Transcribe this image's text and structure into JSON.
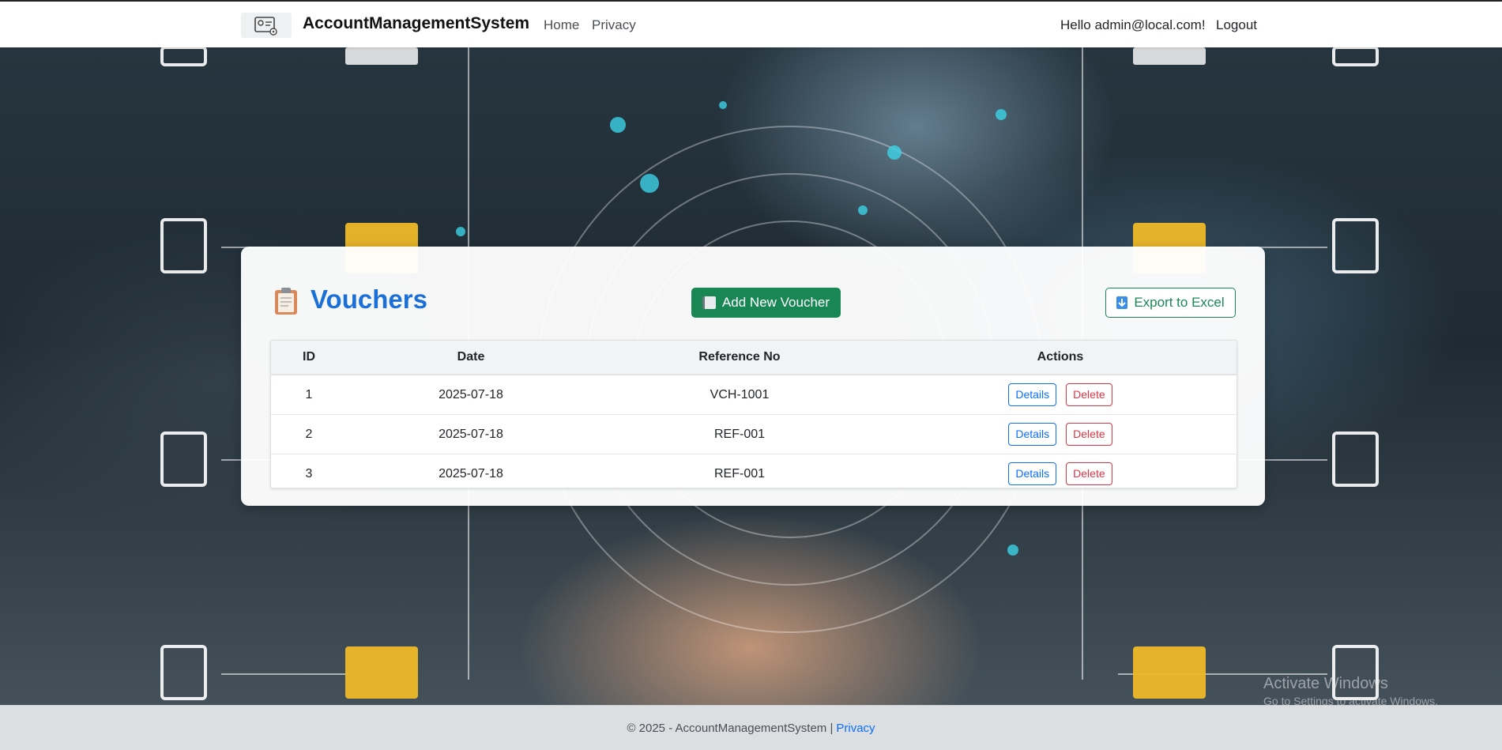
{
  "navbar": {
    "brand": "AccountManagementSystem",
    "links": [
      "Home",
      "Privacy"
    ],
    "greeting": "Hello admin@local.com!",
    "logout": "Logout"
  },
  "page": {
    "title": "Vouchers",
    "add_button": "Add New Voucher",
    "export_button": "Export to Excel"
  },
  "table": {
    "headers": [
      "ID",
      "Date",
      "Reference No",
      "Actions"
    ],
    "rows": [
      {
        "id": "1",
        "date": "2025-07-18",
        "ref": "VCH-1001"
      },
      {
        "id": "2",
        "date": "2025-07-18",
        "ref": "REF-001"
      },
      {
        "id": "3",
        "date": "2025-07-18",
        "ref": "REF-001"
      }
    ],
    "details_label": "Details",
    "delete_label": "Delete"
  },
  "footer": {
    "text": "© 2025 - AccountManagementSystem |",
    "link": "Privacy"
  },
  "watermark": {
    "line1": "Activate Windows",
    "line2": "Go to Settings to activate Windows."
  },
  "colors": {
    "primary": "#1a6fd8",
    "success": "#198754",
    "danger": "#dc3545",
    "link": "#0d6efd"
  },
  "icons": {
    "brand": "account-settings-icon",
    "title": "clipboard-icon",
    "add": "notebook-icon",
    "export": "download-arrow-icon"
  }
}
